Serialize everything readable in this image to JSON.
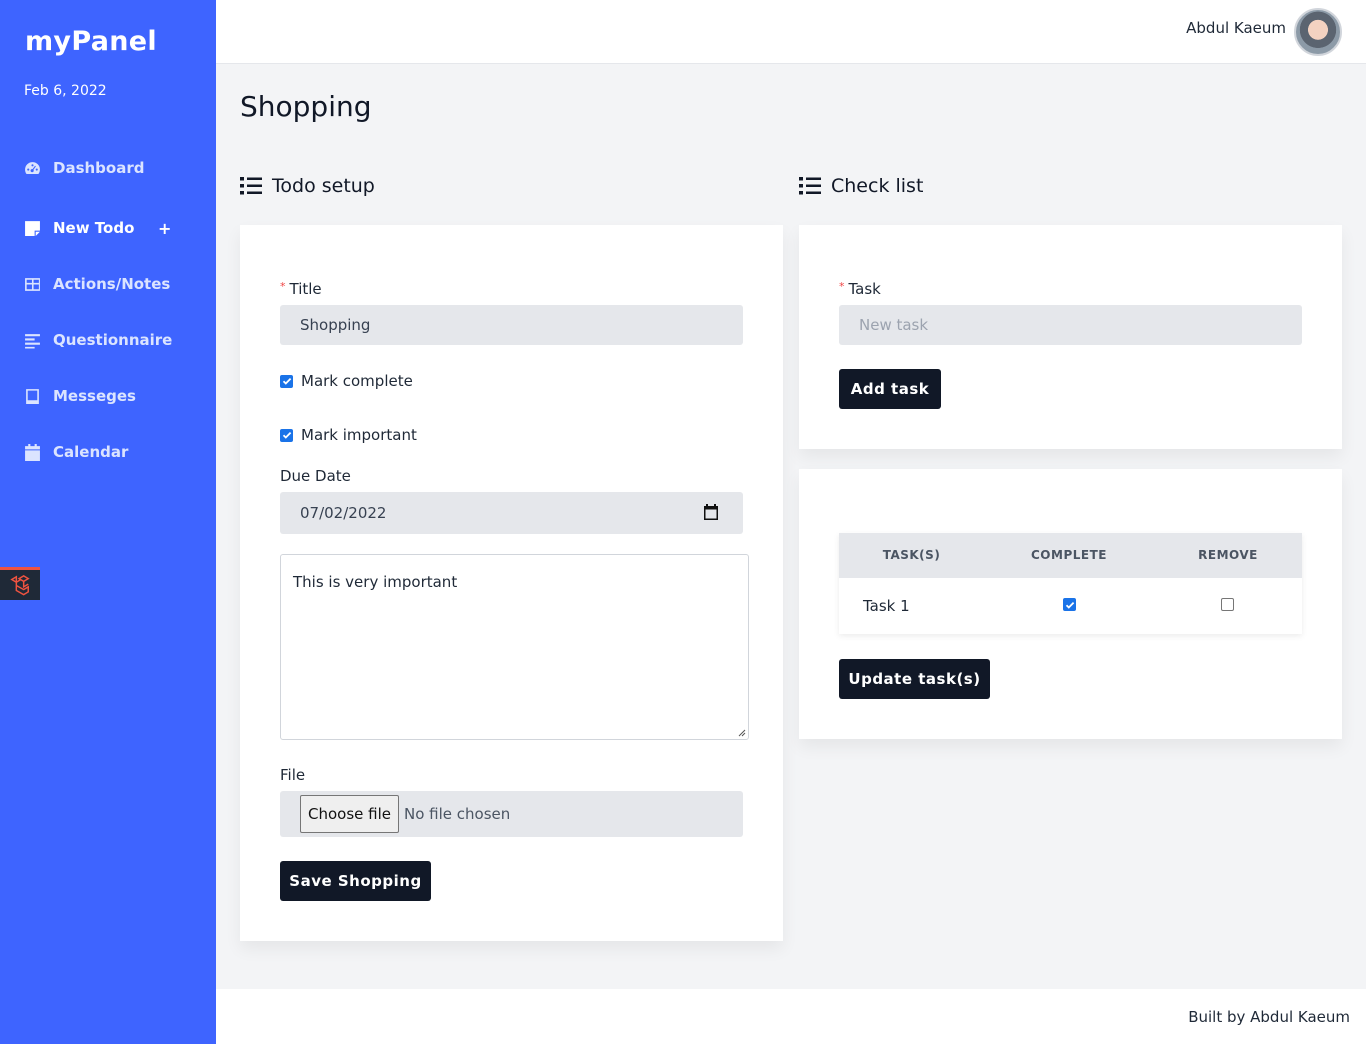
{
  "sidebar": {
    "brand": "myPanel",
    "date": "Feb 6, 2022",
    "items": [
      {
        "label": "Dashboard"
      },
      {
        "label": "New Todo"
      },
      {
        "label": "Actions/Notes"
      },
      {
        "label": "Questionnaire"
      },
      {
        "label": "Messeges"
      },
      {
        "label": "Calendar"
      }
    ],
    "new_todo_plus": "+"
  },
  "topbar": {
    "username": "Abdul Kaeum"
  },
  "page": {
    "title": "Shopping"
  },
  "todo_setup": {
    "heading": "Todo setup",
    "title_label": "Title",
    "required_mark": "*",
    "title_value": "Shopping",
    "mark_complete_label": "Mark complete",
    "mark_complete_checked": true,
    "mark_important_label": "Mark important",
    "mark_important_checked": true,
    "due_date_label": "Due Date",
    "due_date_value": "07/02/2022",
    "notes_value": "This is very important",
    "file_label": "File",
    "choose_file_label": "Choose file",
    "file_status": "No file chosen",
    "save_button": "Save Shopping"
  },
  "check_list": {
    "heading": "Check list",
    "task_label": "Task",
    "required_mark": "*",
    "task_placeholder": "New task",
    "add_button": "Add task",
    "table": {
      "headers": [
        "TASK(S)",
        "COMPLETE",
        "REMOVE"
      ],
      "rows": [
        {
          "task": "Task 1",
          "complete": true,
          "remove": false
        }
      ]
    },
    "update_button": "Update task(s)"
  },
  "footer": {
    "text": "Built by Abdul Kaeum"
  },
  "colors": {
    "sidebar": "#3e64ff",
    "button": "#111827",
    "accent_check": "#1a73e8",
    "required": "#ef4444"
  }
}
